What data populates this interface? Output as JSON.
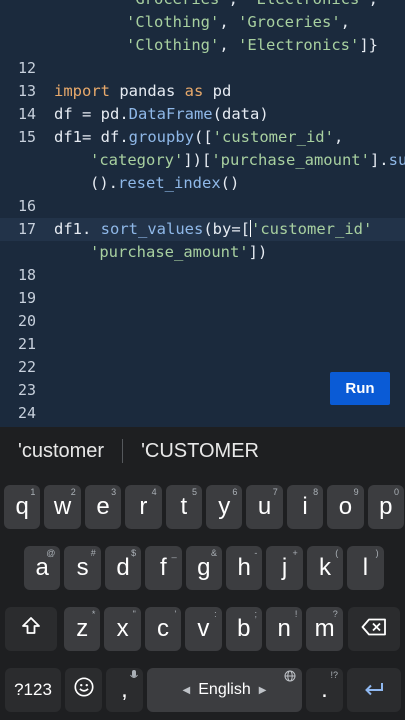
{
  "editor": {
    "lines": [
      {
        "num": "",
        "segments": [
          {
            "t": "'Groceries'",
            "c": "str"
          },
          {
            "t": ", ",
            "c": ""
          },
          {
            "t": "'Electronics'",
            "c": "str"
          },
          {
            "t": ",",
            "c": ""
          }
        ],
        "indent": 2
      },
      {
        "num": "",
        "segments": [
          {
            "t": "'Clothing'",
            "c": "str"
          },
          {
            "t": ", ",
            "c": ""
          },
          {
            "t": "'Groceries'",
            "c": "str"
          },
          {
            "t": ",",
            "c": ""
          }
        ],
        "indent": 2
      },
      {
        "num": "",
        "segments": [
          {
            "t": "'Clothing'",
            "c": "str"
          },
          {
            "t": ", ",
            "c": ""
          },
          {
            "t": "'Electronics'",
            "c": "str"
          },
          {
            "t": "]}",
            "c": ""
          }
        ],
        "indent": 2
      },
      {
        "num": "12",
        "segments": [],
        "indent": 0
      },
      {
        "num": "13",
        "segments": [
          {
            "t": "import",
            "c": "kw"
          },
          {
            "t": " pandas ",
            "c": ""
          },
          {
            "t": "as",
            "c": "kw"
          },
          {
            "t": " pd",
            "c": ""
          }
        ],
        "indent": 0
      },
      {
        "num": "14",
        "segments": [
          {
            "t": "df = pd.",
            "c": ""
          },
          {
            "t": "DataFrame",
            "c": "fn"
          },
          {
            "t": "(data)",
            "c": ""
          }
        ],
        "indent": 0
      },
      {
        "num": "15",
        "segments": [
          {
            "t": "df1= df.",
            "c": ""
          },
          {
            "t": "groupby",
            "c": "fn"
          },
          {
            "t": "([",
            "c": ""
          },
          {
            "t": "'customer_id'",
            "c": "str"
          },
          {
            "t": ",",
            "c": ""
          }
        ],
        "indent": 0
      },
      {
        "num": "",
        "segments": [
          {
            "t": "'category'",
            "c": "str"
          },
          {
            "t": "])[",
            "c": ""
          },
          {
            "t": "'purchase_amount'",
            "c": "str"
          },
          {
            "t": "].",
            "c": ""
          },
          {
            "t": "sum",
            "c": "fn"
          }
        ],
        "indent": 1
      },
      {
        "num": "",
        "segments": [
          {
            "t": "().",
            "c": ""
          },
          {
            "t": "reset_index",
            "c": "fn"
          },
          {
            "t": "()",
            "c": ""
          }
        ],
        "indent": 1
      },
      {
        "num": "16",
        "segments": [],
        "indent": 0
      },
      {
        "num": "17",
        "segments": [
          {
            "t": "df1. ",
            "c": ""
          },
          {
            "t": "sort_values",
            "c": "fn"
          },
          {
            "t": "(by=[",
            "c": ""
          },
          {
            "t": "CARET",
            "c": "caret"
          },
          {
            "t": "'customer_id'",
            "c": "str"
          }
        ],
        "indent": 0,
        "current": true
      },
      {
        "num": "",
        "segments": [
          {
            "t": "'purchase_amount'",
            "c": "str"
          },
          {
            "t": "])",
            "c": ""
          }
        ],
        "indent": 1
      },
      {
        "num": "18",
        "segments": [],
        "indent": 0
      },
      {
        "num": "19",
        "segments": [],
        "indent": 0
      },
      {
        "num": "20",
        "segments": [],
        "indent": 0
      },
      {
        "num": "21",
        "segments": [],
        "indent": 0
      },
      {
        "num": "22",
        "segments": [],
        "indent": 0
      },
      {
        "num": "23",
        "segments": [],
        "indent": 0
      },
      {
        "num": "24",
        "segments": [],
        "indent": 0
      }
    ],
    "run_label": "Run"
  },
  "suggestions": [
    "'customer",
    "'CUSTOMER"
  ],
  "keyboard": {
    "row1": [
      {
        "k": "q",
        "h": "1"
      },
      {
        "k": "w",
        "h": "2"
      },
      {
        "k": "e",
        "h": "3"
      },
      {
        "k": "r",
        "h": "4"
      },
      {
        "k": "t",
        "h": "5"
      },
      {
        "k": "y",
        "h": "6"
      },
      {
        "k": "u",
        "h": "7"
      },
      {
        "k": "i",
        "h": "8"
      },
      {
        "k": "o",
        "h": "9"
      },
      {
        "k": "p",
        "h": "0"
      }
    ],
    "row2": [
      {
        "k": "a",
        "h": "@"
      },
      {
        "k": "s",
        "h": "#"
      },
      {
        "k": "d",
        "h": "$"
      },
      {
        "k": "f",
        "h": "_"
      },
      {
        "k": "g",
        "h": "&"
      },
      {
        "k": "h",
        "h": "-"
      },
      {
        "k": "j",
        "h": "+"
      },
      {
        "k": "k",
        "h": "("
      },
      {
        "k": "l",
        "h": ")"
      }
    ],
    "row3": [
      {
        "k": "z",
        "h": "*"
      },
      {
        "k": "x",
        "h": "\""
      },
      {
        "k": "c",
        "h": "'"
      },
      {
        "k": "v",
        "h": ":"
      },
      {
        "k": "b",
        "h": ";"
      },
      {
        "k": "n",
        "h": "!"
      },
      {
        "k": "m",
        "h": "?"
      }
    ],
    "symbols_label": "?123",
    "comma_label": ",",
    "space_label": "English",
    "period_label": ".",
    "period_hint": "!?",
    "icons": {
      "shift": "shift-icon",
      "backspace": "backspace-icon",
      "emoji": "emoji-icon",
      "mic": "microphone-icon",
      "globe": "globe-icon",
      "enter": "enter-icon"
    }
  }
}
